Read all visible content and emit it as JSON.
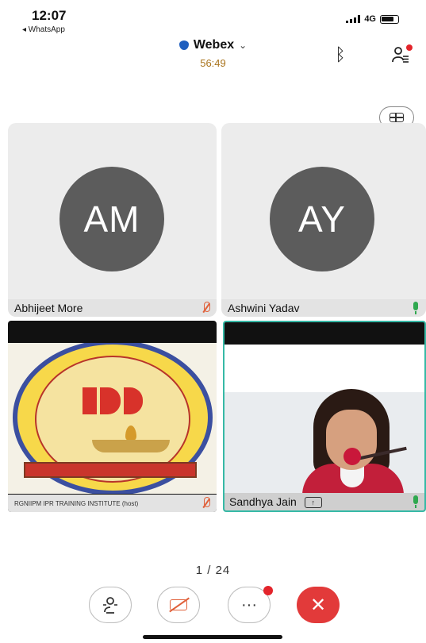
{
  "status_bar": {
    "time": "12:07",
    "back_app": "◂ WhatsApp",
    "network": "4G"
  },
  "meeting": {
    "title": "Webex",
    "elapsed": "56:49"
  },
  "participants": [
    {
      "initials": "AM",
      "name": "Abhijeet More",
      "mic": "muted"
    },
    {
      "initials": "AY",
      "name": "Ashwini Yadav",
      "mic": "on"
    },
    {
      "name": "RGNIIPM IPR TRAINING INSTITUTE (host)",
      "mic": "muted"
    },
    {
      "name": "Sandhya Jain",
      "mic": "on"
    }
  ],
  "pagination": {
    "label": "1 / 24"
  },
  "colors": {
    "end_call": "#e23a3a",
    "active_border": "#36b9a6",
    "muted_mic": "#e0603a",
    "live_mic": "#2fa84f",
    "timer": "#a9741d"
  },
  "icons": {
    "bluetooth": "bluetooth-icon",
    "participants": "participants-icon",
    "layout": "grid-layout-icon",
    "audio": "audio-connect-icon",
    "camera": "camera-off-icon",
    "more": "more-icon",
    "end": "close-icon"
  }
}
